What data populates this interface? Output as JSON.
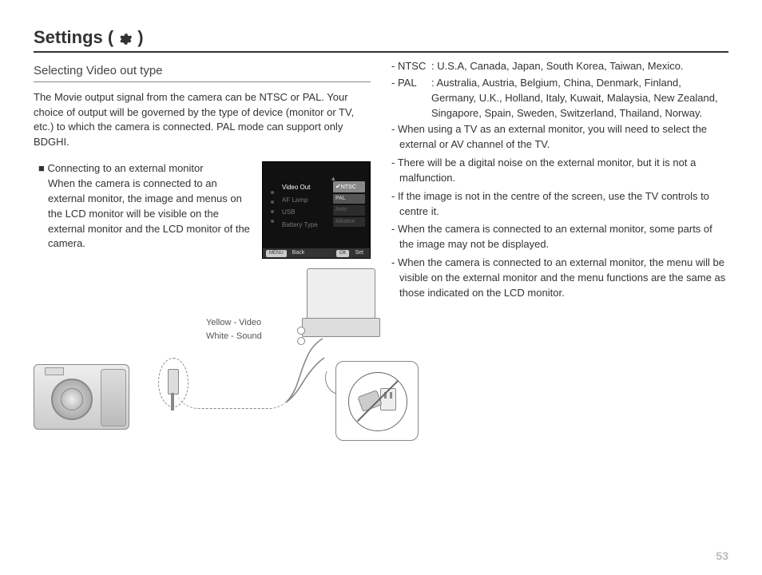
{
  "page_number": "53",
  "title": {
    "prefix": "Settings (",
    "suffix": " )"
  },
  "left": {
    "section": "Selecting Video out type",
    "intro": "The Movie output signal from the camera can be NTSC or PAL. Your choice of output will be governed by the type of device (monitor or TV, etc.) to which the camera is connected. PAL mode can support only BDGHI.",
    "subsection_label": "Connecting to an external monitor",
    "subsection_text": "When the camera is connected to an external monitor, the image and menus on the LCD monitor will be visible on the external monitor and the LCD monitor of the camera.",
    "cable_labels": {
      "video": "Yellow - Video",
      "audio": "White - Sound"
    }
  },
  "lcd": {
    "menu": [
      "Video Out",
      "AF Lamp",
      "USB",
      "Battery Type"
    ],
    "menu_selected_index": 0,
    "options": [
      {
        "label": "NTSC",
        "selected": true
      },
      {
        "label": "PAL",
        "selected": false
      },
      {
        "label": "Auto",
        "selected": false
      },
      {
        "label": "Alkaline",
        "selected": false
      }
    ],
    "bottom": {
      "back_key": "MENU",
      "back": "Back",
      "set_key": "OK",
      "set": "Set"
    }
  },
  "right": {
    "defs": [
      {
        "k": "- NTSC",
        "v": ": U.S.A, Canada, Japan, South Korea, Taiwan, Mexico."
      },
      {
        "k": "- PAL",
        "v": ": Australia, Austria, Belgium, China, Denmark, Finland, Germany, U.K., Holland, Italy, Kuwait, Malaysia, New Zealand, Singapore, Spain, Sweden, Switzerland, Thailand, Norway."
      }
    ],
    "bullets": [
      "- When using a TV as an external monitor, you will need to select the external or AV channel of the TV.",
      "- There will be a digital noise on the external monitor, but it is not a malfunction.",
      "- If the image is not in the centre of the screen, use the TV controls to centre it.",
      "- When the camera is connected to an external monitor, some parts of the image may not be displayed.",
      "- When the camera is connected to an external monitor, the menu will be visible on the external monitor and the menu functions are the same as those indicated on the LCD monitor."
    ]
  }
}
